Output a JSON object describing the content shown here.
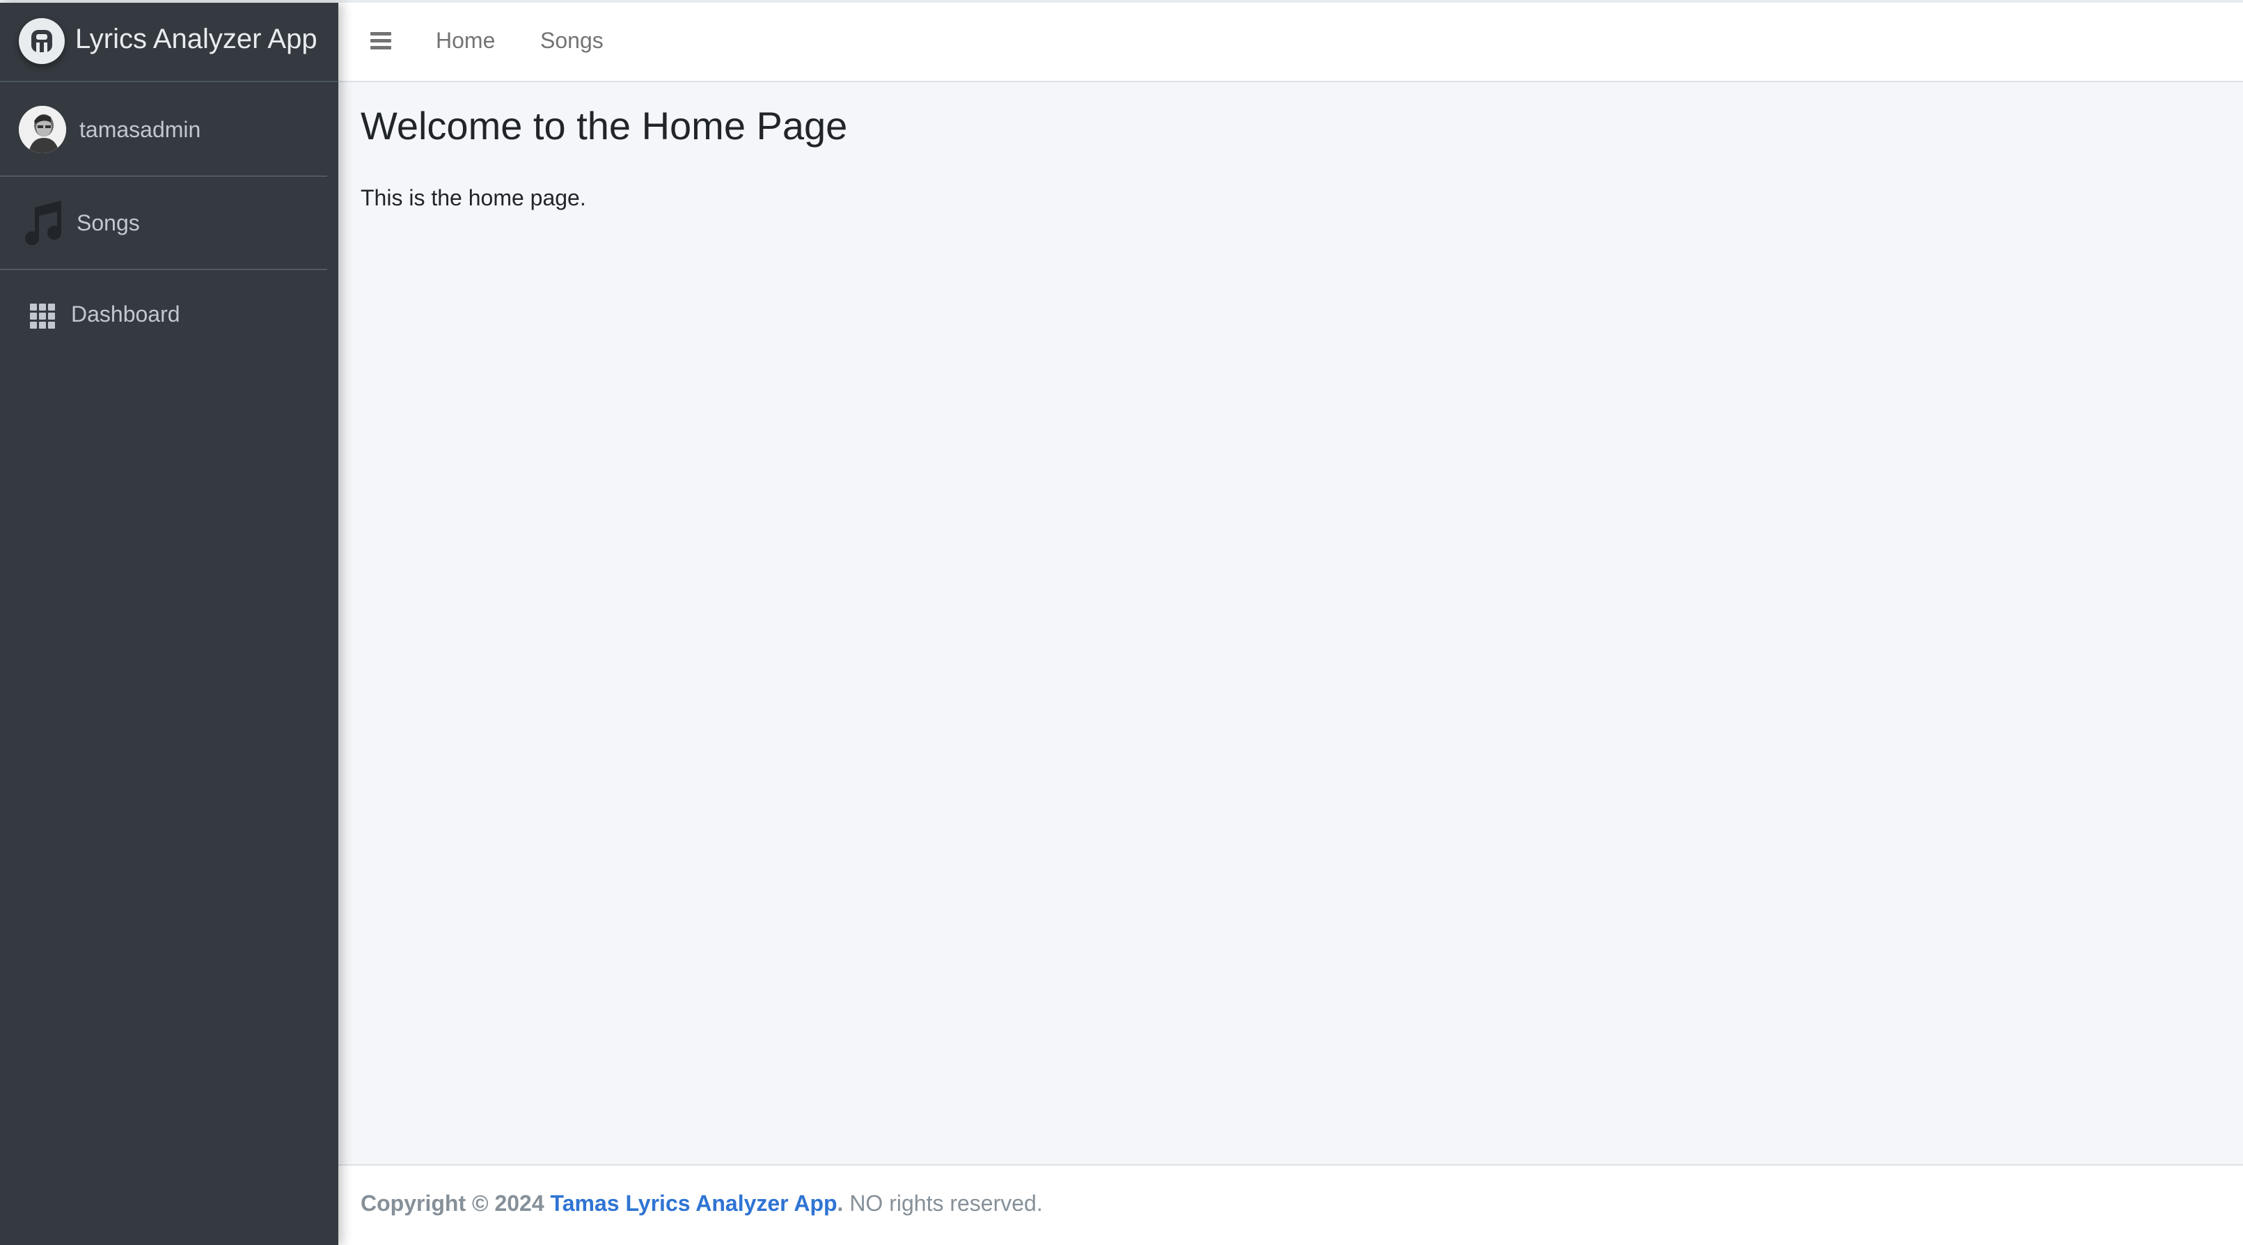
{
  "brand": {
    "title": "Lyrics Analyzer App"
  },
  "user": {
    "name": "tamasadmin"
  },
  "sidebar": {
    "songs_label": "Songs",
    "items": [
      {
        "label": "Dashboard",
        "icon": "grid-icon"
      }
    ]
  },
  "navbar": {
    "menu_icon": "hamburger-icon",
    "links": [
      {
        "label": "Home"
      },
      {
        "label": "Songs"
      }
    ]
  },
  "main": {
    "title": "Welcome to the Home Page",
    "body": "This is the home page."
  },
  "footer": {
    "copyright_prefix": "Copyright © 2024",
    "link_text": "Tamas Lyrics Analyzer App",
    "period": ".",
    "suffix": " NO rights reserved."
  },
  "colors": {
    "sidebar_bg": "#343a40",
    "content_bg": "#f4f6f9",
    "link_accent": "#2f74d3",
    "sidebar_text": "#c2c7d0"
  }
}
